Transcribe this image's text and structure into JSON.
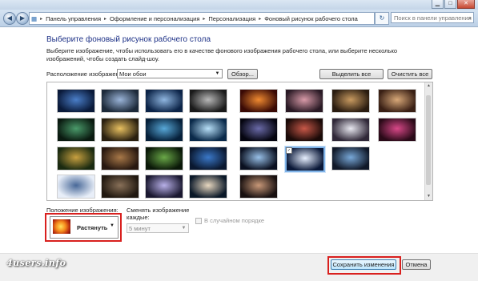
{
  "window": {
    "min_label": "▁",
    "max_label": "□",
    "close_label": "✕"
  },
  "address_bar": {
    "back_icon": "back-arrow-icon",
    "forward_icon": "forward-arrow-icon",
    "crumbs": [
      "Панель управления",
      "Оформление и персонализация",
      "Персонализация",
      "Фоновый рисунок рабочего стола"
    ],
    "search_placeholder": "Поиск в панели управления"
  },
  "main": {
    "title": "Выберите фоновый рисунок рабочего стола",
    "description": "Выберите изображение, чтобы использовать его в качестве фонового изображения рабочего стола, или выберите несколько изображений, чтобы создать слайд-шоу.",
    "location_label": "Расположение изображения:",
    "location_value": "Мои обои",
    "browse_label": "Обзор...",
    "select_all_label": "Выделить все",
    "clear_all_label": "Очистить все"
  },
  "gallery": {
    "thumbnails": [
      {
        "row": 0,
        "col": 0,
        "colors": [
          "#0a1a3a",
          "#4a7ec8"
        ]
      },
      {
        "row": 0,
        "col": 1,
        "colors": [
          "#1d2a3a",
          "#9ab4d8"
        ]
      },
      {
        "row": 0,
        "col": 2,
        "colors": [
          "#0c2448",
          "#8fb6e0"
        ]
      },
      {
        "row": 0,
        "col": 3,
        "colors": [
          "#1a1a1a",
          "#b8b8b8"
        ]
      },
      {
        "row": 0,
        "col": 4,
        "colors": [
          "#3a0a05",
          "#f08a30"
        ]
      },
      {
        "row": 0,
        "col": 5,
        "colors": [
          "#2a1a25",
          "#d89aa8"
        ]
      },
      {
        "row": 0,
        "col": 6,
        "colors": [
          "#2a1c10",
          "#c89a60"
        ]
      },
      {
        "row": 0,
        "col": 7,
        "colors": [
          "#3a2015",
          "#d8a878"
        ]
      },
      {
        "row": 1,
        "col": 0,
        "colors": [
          "#0a1a10",
          "#4a9a6a"
        ]
      },
      {
        "row": 1,
        "col": 1,
        "colors": [
          "#2a2010",
          "#e8c060"
        ]
      },
      {
        "row": 1,
        "col": 2,
        "colors": [
          "#06203a",
          "#58a8d8"
        ]
      },
      {
        "row": 1,
        "col": 3,
        "colors": [
          "#0a2a4a",
          "#b8e0f8"
        ]
      },
      {
        "row": 1,
        "col": 4,
        "colors": [
          "#050510",
          "#6a6aa8"
        ]
      },
      {
        "row": 1,
        "col": 5,
        "colors": [
          "#1a0a08",
          "#c85848"
        ]
      },
      {
        "row": 1,
        "col": 6,
        "colors": [
          "#302838",
          "#e8e8f0"
        ]
      },
      {
        "row": 1,
        "col": 7,
        "colors": [
          "#2a0a18",
          "#d84888"
        ]
      },
      {
        "row": 2,
        "col": 0,
        "colors": [
          "#1a2a10",
          "#c8a040"
        ]
      },
      {
        "row": 2,
        "col": 1,
        "colors": [
          "#281810",
          "#a87848"
        ]
      },
      {
        "row": 2,
        "col": 2,
        "colors": [
          "#0a1808",
          "#6aa848"
        ]
      },
      {
        "row": 2,
        "col": 3,
        "colors": [
          "#0a1830",
          "#3a78c8"
        ]
      },
      {
        "row": 2,
        "col": 4,
        "colors": [
          "#0a1020",
          "#98c0e8"
        ]
      },
      {
        "row": 2,
        "col": 5,
        "colors": [
          "#0a1838",
          "#e8f0ff"
        ]
      },
      {
        "row": 2,
        "col": 6,
        "colors": [
          "#101828",
          "#78a8d8"
        ]
      },
      {
        "row": 3,
        "col": 0,
        "colors": [
          "#e8eef8",
          "#486898"
        ]
      },
      {
        "row": 3,
        "col": 1,
        "colors": [
          "#201810",
          "#887058"
        ]
      },
      {
        "row": 3,
        "col": 2,
        "colors": [
          "#1a1830",
          "#b8b0e8"
        ]
      },
      {
        "row": 3,
        "col": 3,
        "colors": [
          "#0a1828",
          "#e8d8c0"
        ]
      },
      {
        "row": 3,
        "col": 4,
        "colors": [
          "#181010",
          "#c89878"
        ]
      }
    ],
    "selected_index": 21
  },
  "position": {
    "label": "Положение изображения:",
    "value": "Растянуть"
  },
  "change": {
    "label": "Сменять изображение каждые:",
    "interval": "5 минут",
    "shuffle_label": "В случайном порядке"
  },
  "footer": {
    "save_label": "Сохранить изменения",
    "cancel_label": "Отмена"
  },
  "watermark": "4users.info"
}
